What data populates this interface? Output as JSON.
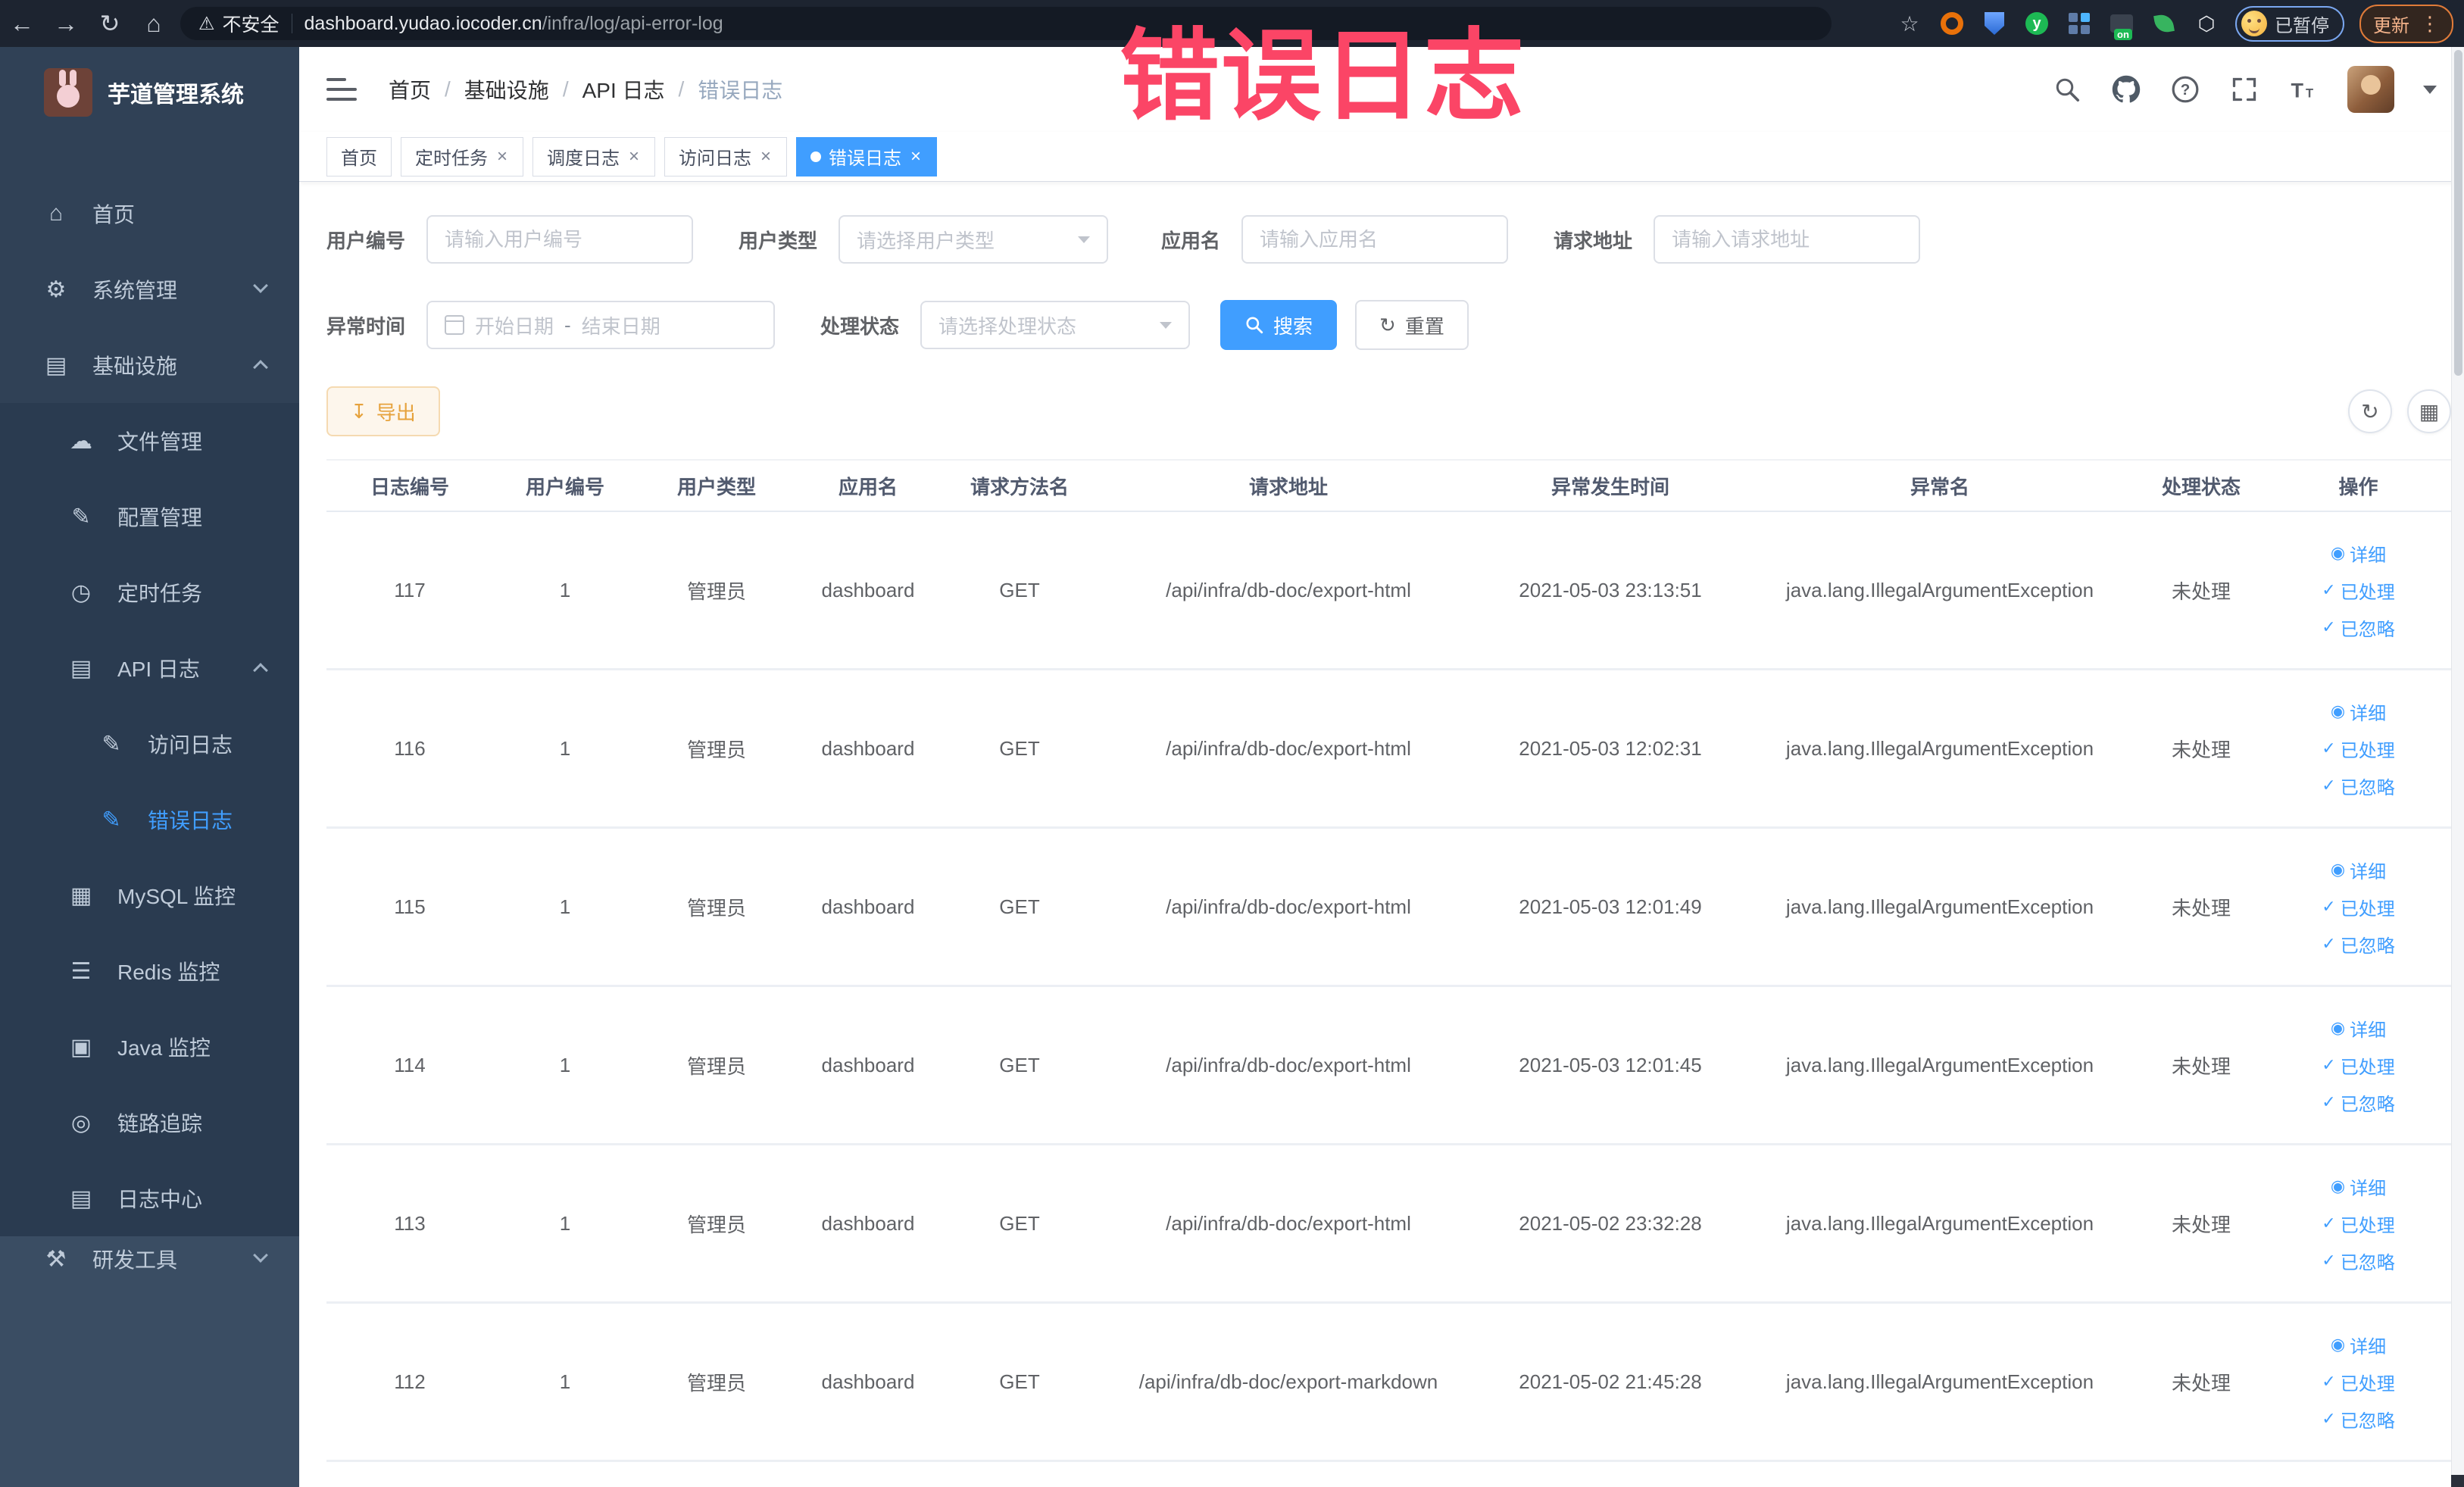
{
  "browser": {
    "security_label": "不安全",
    "url_domain": "dashboard.yudao.iocoder.cn",
    "url_path": "/infra/log/api-error-log",
    "paused_label": "已暂停",
    "update_label": "更新",
    "extension_y_letter": "y"
  },
  "overlay": {
    "text": "错误日志",
    "color": "#fb4566"
  },
  "sidebar": {
    "title": "芋道管理系统",
    "items": [
      {
        "label": "首页",
        "icon": "home-icon",
        "glyph": "⌂",
        "level": 1
      },
      {
        "label": "系统管理",
        "icon": "gear-icon",
        "glyph": "⚙",
        "level": 1,
        "chevron": "down"
      },
      {
        "label": "基础设施",
        "icon": "infrastructure-icon",
        "glyph": "▤",
        "level": 1,
        "chevron": "up"
      },
      {
        "label": "文件管理",
        "icon": "file-manage-icon",
        "glyph": "☁",
        "level": 2,
        "sub": true
      },
      {
        "label": "配置管理",
        "icon": "config-manage-icon",
        "glyph": "✎",
        "level": 2,
        "sub": true
      },
      {
        "label": "定时任务",
        "icon": "scheduled-task-icon",
        "glyph": "◷",
        "level": 2,
        "sub": true
      },
      {
        "label": "API 日志",
        "icon": "api-log-icon",
        "glyph": "▤",
        "level": 2,
        "sub": true,
        "chevron": "up"
      },
      {
        "label": "访问日志",
        "icon": "access-log-icon",
        "glyph": "✎",
        "level": 3,
        "sub": true
      },
      {
        "label": "错误日志",
        "icon": "error-log-icon",
        "glyph": "✎",
        "level": 3,
        "sub": true,
        "active": true
      },
      {
        "label": "MySQL 监控",
        "icon": "mysql-monitor-icon",
        "glyph": "▦",
        "level": 2,
        "sub": true
      },
      {
        "label": "Redis 监控",
        "icon": "redis-monitor-icon",
        "glyph": "☰",
        "level": 2,
        "sub": true
      },
      {
        "label": "Java 监控",
        "icon": "java-monitor-icon",
        "glyph": "▣",
        "level": 2,
        "sub": true
      },
      {
        "label": "链路追踪",
        "icon": "trace-icon",
        "glyph": "◎",
        "level": 2,
        "sub": true
      },
      {
        "label": "日志中心",
        "icon": "log-center-icon",
        "glyph": "▤",
        "level": 2,
        "sub": true
      },
      {
        "label": "研发工具",
        "icon": "devtools-icon",
        "glyph": "⚒",
        "level": 1,
        "chevron": "down",
        "devtools": true
      }
    ]
  },
  "breadcrumb": {
    "items": [
      "首页",
      "基础设施",
      "API 日志",
      "错误日志"
    ]
  },
  "tabs": [
    {
      "label": "首页",
      "closable": false,
      "active": false
    },
    {
      "label": "定时任务",
      "closable": true,
      "active": false
    },
    {
      "label": "调度日志",
      "closable": true,
      "active": false
    },
    {
      "label": "访问日志",
      "closable": true,
      "active": false
    },
    {
      "label": "错误日志",
      "closable": true,
      "active": true
    }
  ],
  "filters": {
    "user_id_label": "用户编号",
    "user_id_placeholder": "请输入用户编号",
    "user_type_label": "用户类型",
    "user_type_placeholder": "请选择用户类型",
    "app_name_label": "应用名",
    "app_name_placeholder": "请输入应用名",
    "request_url_label": "请求地址",
    "request_url_placeholder": "请输入请求地址",
    "exception_time_label": "异常时间",
    "date_start_placeholder": "开始日期",
    "date_separator": "-",
    "date_end_placeholder": "结束日期",
    "process_status_label": "处理状态",
    "process_status_placeholder": "请选择处理状态",
    "search_label": "搜索",
    "reset_label": "重置"
  },
  "toolbar": {
    "export_label": "导出"
  },
  "table": {
    "columns": [
      "日志编号",
      "用户编号",
      "用户类型",
      "应用名",
      "请求方法名",
      "请求地址",
      "异常发生时间",
      "异常名",
      "处理状态",
      "操作"
    ],
    "actions": [
      {
        "label": "详细",
        "icon": "eye-icon",
        "glyph": "◉"
      },
      {
        "label": "已处理",
        "icon": "check-icon",
        "glyph": "✓"
      },
      {
        "label": "已忽略",
        "icon": "check-icon",
        "glyph": "✓"
      }
    ],
    "rows": [
      {
        "id": "117",
        "user_id": "1",
        "user_type": "管理员",
        "app": "dashboard",
        "method": "GET",
        "url": "/api/infra/db-doc/export-html",
        "time": "2021-05-03 23:13:51",
        "exception": "java.lang.IllegalArgumentException",
        "status": "未处理"
      },
      {
        "id": "116",
        "user_id": "1",
        "user_type": "管理员",
        "app": "dashboard",
        "method": "GET",
        "url": "/api/infra/db-doc/export-html",
        "time": "2021-05-03 12:02:31",
        "exception": "java.lang.IllegalArgumentException",
        "status": "未处理"
      },
      {
        "id": "115",
        "user_id": "1",
        "user_type": "管理员",
        "app": "dashboard",
        "method": "GET",
        "url": "/api/infra/db-doc/export-html",
        "time": "2021-05-03 12:01:49",
        "exception": "java.lang.IllegalArgumentException",
        "status": "未处理"
      },
      {
        "id": "114",
        "user_id": "1",
        "user_type": "管理员",
        "app": "dashboard",
        "method": "GET",
        "url": "/api/infra/db-doc/export-html",
        "time": "2021-05-03 12:01:45",
        "exception": "java.lang.IllegalArgumentException",
        "status": "未处理"
      },
      {
        "id": "113",
        "user_id": "1",
        "user_type": "管理员",
        "app": "dashboard",
        "method": "GET",
        "url": "/api/infra/db-doc/export-html",
        "time": "2021-05-02 23:32:28",
        "exception": "java.lang.IllegalArgumentException",
        "status": "未处理"
      },
      {
        "id": "112",
        "user_id": "1",
        "user_type": "管理员",
        "app": "dashboard",
        "method": "GET",
        "url": "/api/infra/db-doc/export-markdown",
        "time": "2021-05-02 21:45:28",
        "exception": "java.lang.IllegalArgumentException",
        "status": "未处理"
      }
    ]
  },
  "colors": {
    "primary": "#409eff",
    "sidebar_bg": "#304156",
    "overlay_red": "#fb4566",
    "warning_text": "#e6a23c",
    "warning_bg": "#fdf6ec",
    "warning_border": "#f5dab1"
  }
}
